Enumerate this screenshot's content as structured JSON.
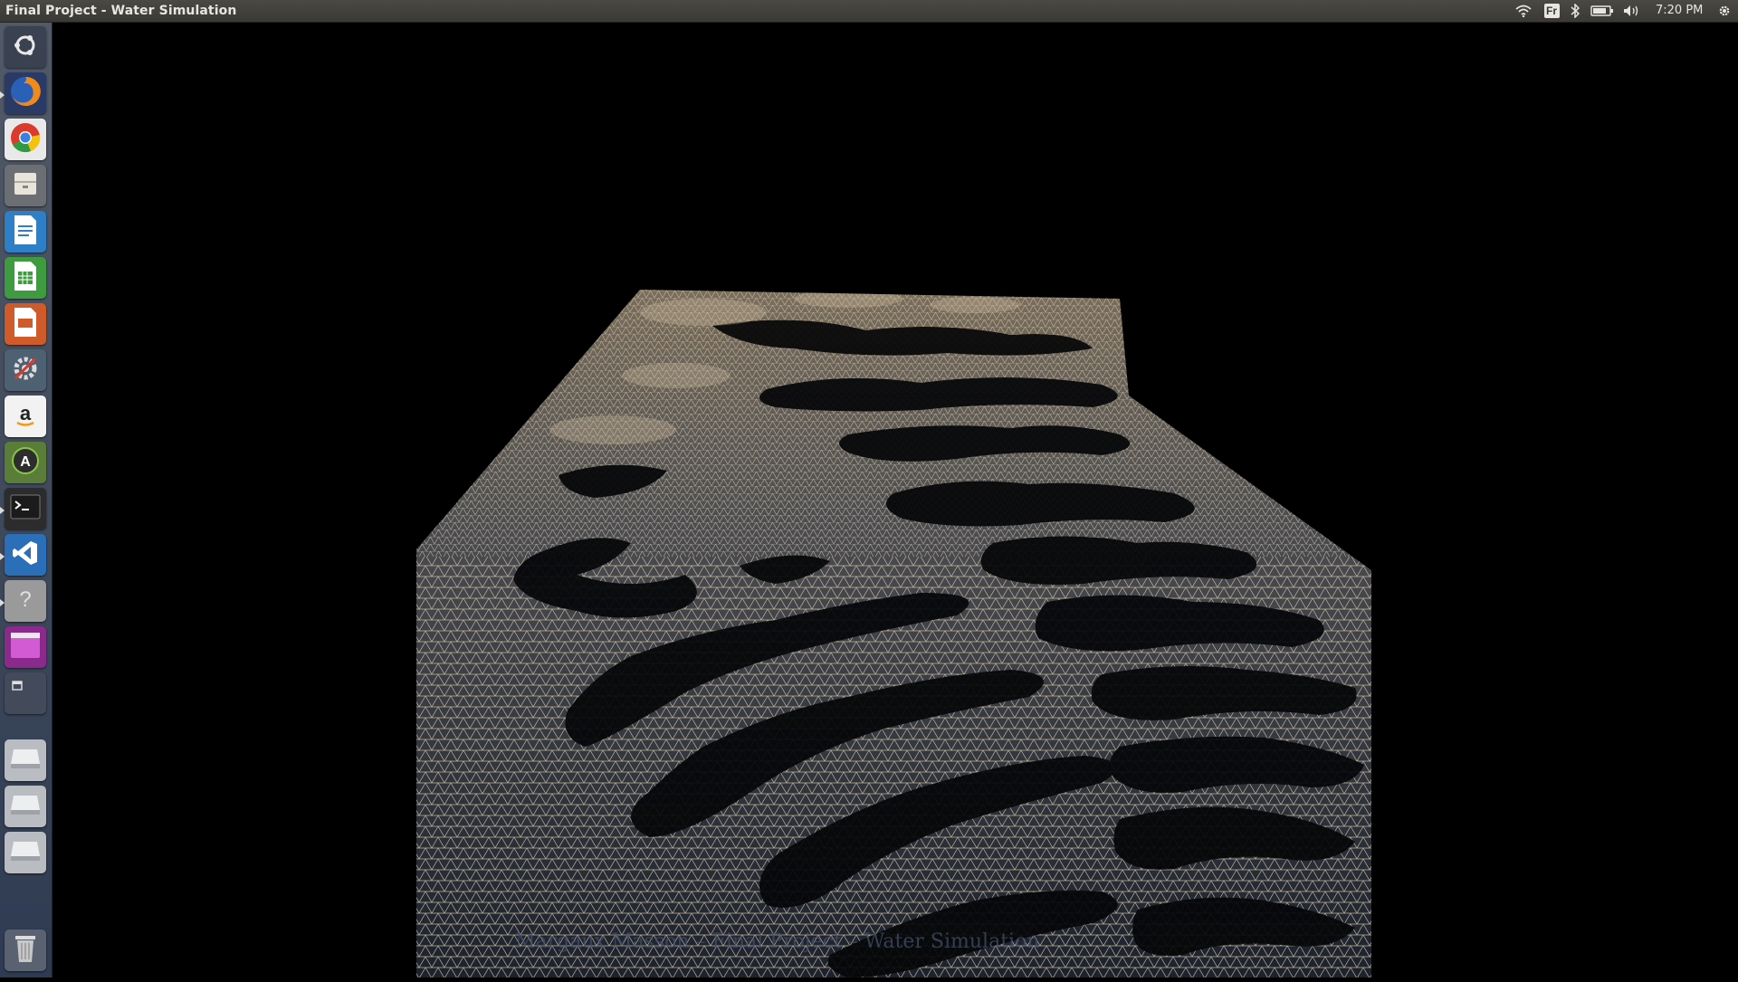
{
  "window": {
    "title": "Final Project - Water Simulation"
  },
  "panel": {
    "keyboard_layout": "Fr",
    "clock": "7:20 PM",
    "indicators": [
      "wifi-icon",
      "keyboard-layout",
      "bluetooth-icon",
      "battery-icon",
      "volume-icon",
      "clock",
      "gear-icon"
    ]
  },
  "launcher": {
    "items": [
      {
        "name": "dash-home",
        "icon": "ubuntu-logo-icon"
      },
      {
        "name": "firefox",
        "icon": "firefox-icon"
      },
      {
        "name": "chrome",
        "icon": "chrome-icon"
      },
      {
        "name": "files",
        "icon": "file-cabinet-icon"
      },
      {
        "name": "libreoffice-writer",
        "icon": "writer-icon"
      },
      {
        "name": "libreoffice-calc",
        "icon": "calc-icon"
      },
      {
        "name": "libreoffice-impress",
        "icon": "impress-icon"
      },
      {
        "name": "system-settings",
        "icon": "settings-icon"
      },
      {
        "name": "amazon",
        "icon": "amazon-icon"
      },
      {
        "name": "software-updater",
        "icon": "updater-icon"
      },
      {
        "name": "terminal",
        "icon": "terminal-icon"
      },
      {
        "name": "visual-studio-code",
        "icon": "vscode-icon"
      },
      {
        "name": "help",
        "icon": "help-icon"
      },
      {
        "name": "workspace-switcher",
        "icon": "workspace-icon"
      },
      {
        "name": "app-window",
        "icon": "window-icon"
      },
      {
        "name": "drive-1",
        "icon": "drive-icon"
      },
      {
        "name": "drive-2",
        "icon": "drive-icon"
      },
      {
        "name": "drive-3",
        "icon": "drive-icon"
      },
      {
        "name": "trash",
        "icon": "trash-icon"
      }
    ],
    "accent": "#dcdcdc"
  },
  "scene": {
    "watermark": "Margaux Masson – Final Project – Water Simulation",
    "colors": {
      "background": "#000000",
      "mesh": "#d8c8a8",
      "water_dark": "#1c222e",
      "water_mid": "#4a4c50"
    }
  }
}
